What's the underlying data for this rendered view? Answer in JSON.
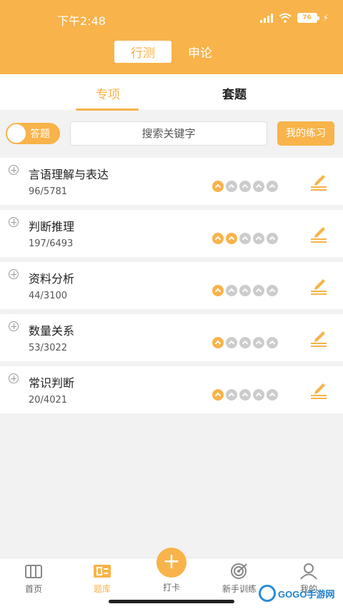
{
  "status_bar": {
    "time": "下午2:48",
    "battery": "76"
  },
  "top_tabs": [
    {
      "label": "行测",
      "active": true
    },
    {
      "label": "申论",
      "active": false
    }
  ],
  "sub_tabs": [
    {
      "label": "专项",
      "active": true
    },
    {
      "label": "套题",
      "active": false
    }
  ],
  "toggle": {
    "label": "答题"
  },
  "search": {
    "placeholder": "搜索关键字"
  },
  "practice_button": {
    "label": "我的练习"
  },
  "categories": [
    {
      "title": "言语理解与表达",
      "count": "96/5781",
      "level": 1
    },
    {
      "title": "判断推理",
      "count": "197/6493",
      "level": 2
    },
    {
      "title": "资料分析",
      "count": "44/3100",
      "level": 1
    },
    {
      "title": "数量关系",
      "count": "53/3022",
      "level": 1
    },
    {
      "title": "常识判断",
      "count": "20/4021",
      "level": 1
    }
  ],
  "level_max": 5,
  "bottom_nav": [
    {
      "label": "首页",
      "icon": "home-icon",
      "active": false
    },
    {
      "label": "题库",
      "icon": "question-bank-icon",
      "active": true
    },
    {
      "label": "打卡",
      "icon": "plus-icon",
      "active": false
    },
    {
      "label": "新手训练",
      "icon": "target-icon",
      "active": false
    },
    {
      "label": "我的",
      "icon": "user-icon",
      "active": false
    }
  ],
  "watermark": {
    "text": "GOGO手游网"
  },
  "colors": {
    "accent": "#f8b34a",
    "background": "#f2f2f2"
  }
}
